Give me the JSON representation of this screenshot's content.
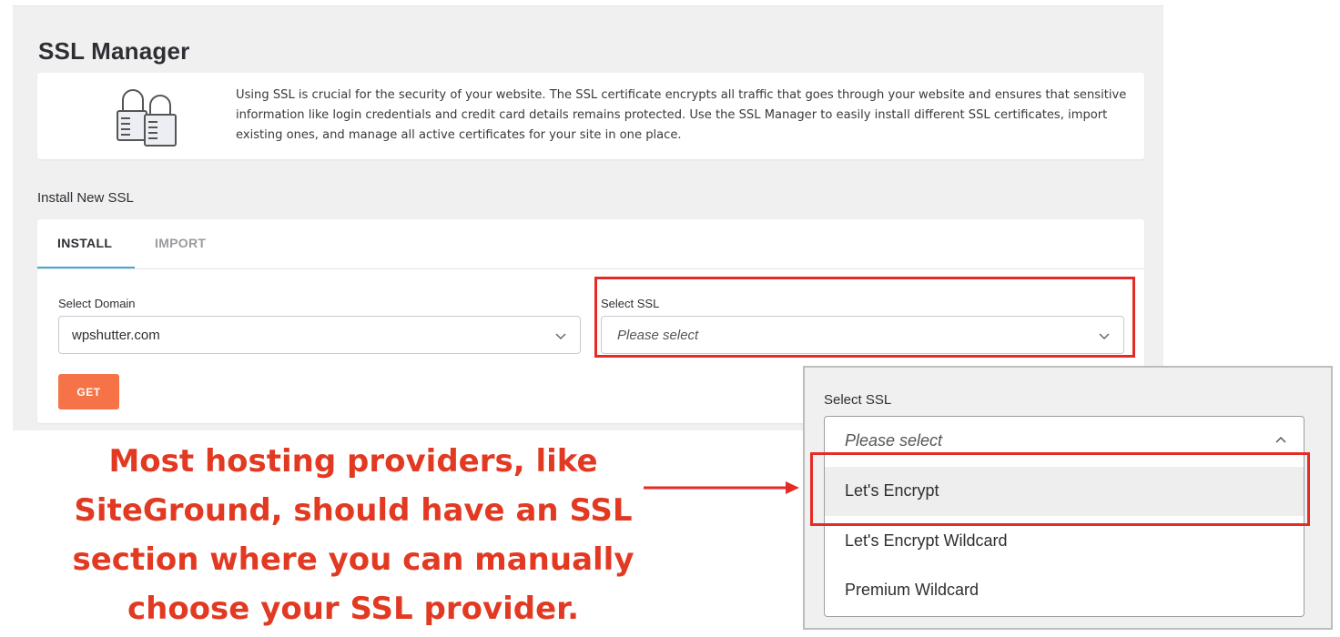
{
  "page": {
    "title": "SSL Manager"
  },
  "intro": {
    "icon": "padlocks-icon",
    "text": "Using SSL is crucial for the security of your website. The SSL certificate encrypts all traffic that goes through your website and ensures that sensitive information like login credentials and credit card details remains protected. Use the SSL Manager to easily install different SSL certificates, import existing ones, and manage all active certificates for your site in one place."
  },
  "install": {
    "section_title": "Install New SSL",
    "tabs": [
      {
        "label": "INSTALL",
        "active": true
      },
      {
        "label": "IMPORT",
        "active": false
      }
    ],
    "domain": {
      "label": "Select Domain",
      "value": "wpshutter.com"
    },
    "ssl": {
      "label": "Select SSL",
      "placeholder": "Please select"
    },
    "get_button": "GET"
  },
  "dropdown_zoom": {
    "label": "Select SSL",
    "placeholder": "Please select",
    "options": [
      "Let's Encrypt",
      "Let's Encrypt Wildcard",
      "Premium Wildcard"
    ],
    "highlighted_option": "Let's Encrypt"
  },
  "annotation": {
    "lines": [
      "Most hosting providers, like",
      "SiteGround, should have an SSL",
      "section where you can manually",
      "choose your SSL provider."
    ]
  },
  "colors": {
    "accent_tab": "#43a7d6",
    "get_button": "#f57346",
    "highlight": "#e52b25",
    "annotation_text": "#e23a22"
  }
}
